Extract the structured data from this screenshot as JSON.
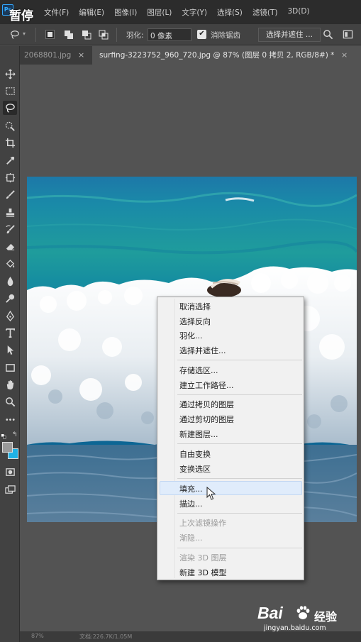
{
  "overlay": {
    "pause_label": "暂停"
  },
  "menubar": {
    "logo": "Ps",
    "items": [
      "文件(F)",
      "编辑(E)",
      "图像(I)",
      "图层(L)",
      "文字(Y)",
      "选择(S)",
      "滤镜(T)",
      "3D(D)"
    ]
  },
  "options_bar": {
    "feather_label": "羽化:",
    "feather_value": "0 像素",
    "antialias_label": "消除锯齿",
    "antialias_checked": true,
    "select_mask_label": "选择并遮住 ..."
  },
  "tabs": [
    {
      "label": "2068801.jpg",
      "close": "×"
    },
    {
      "label": "surfing-3223752_960_720.jpg @ 87% (图层 0 拷贝 2, RGB/8#) *",
      "close": "×"
    }
  ],
  "toolbar": {
    "tools": [
      "move-icon",
      "marquee-icon",
      "lasso-icon",
      "quick-select-icon",
      "crop-icon",
      "eyedropper-icon",
      "frame-icon",
      "brush-icon",
      "stamp-icon",
      "history-brush-icon",
      "eraser-icon",
      "paint-bucket-icon",
      "blur-icon",
      "dodge-icon",
      "pen-icon",
      "type-icon",
      "path-select-icon",
      "rectangle-icon",
      "hand-icon",
      "zoom-icon",
      "more-icon"
    ],
    "foreground_color": "#9a9a9a",
    "background_color": "#1fb2e6"
  },
  "context_menu": {
    "items": [
      {
        "label": "取消选择",
        "enabled": true
      },
      {
        "label": "选择反向",
        "enabled": true
      },
      {
        "label": "羽化...",
        "enabled": true
      },
      {
        "label": "选择并遮住...",
        "enabled": true
      },
      {
        "label": "存储选区...",
        "enabled": true
      },
      {
        "label": "建立工作路径...",
        "enabled": true
      },
      {
        "label": "通过拷贝的图层",
        "enabled": true
      },
      {
        "label": "通过剪切的图层",
        "enabled": true
      },
      {
        "label": "新建图层...",
        "enabled": true
      },
      {
        "label": "自由变换",
        "enabled": true
      },
      {
        "label": "变换选区",
        "enabled": true
      },
      {
        "label": "填充...",
        "enabled": true,
        "highlighted": true
      },
      {
        "label": "描边...",
        "enabled": true
      },
      {
        "label": "上次滤镜操作",
        "enabled": false
      },
      {
        "label": "渐隐...",
        "enabled": false
      },
      {
        "label": "渲染 3D 图层",
        "enabled": false
      },
      {
        "label": "新建 3D 模型",
        "enabled": true
      }
    ]
  },
  "status_bar": {
    "zoom": "87%",
    "doc_info": "文档:226.7K/1.05M"
  },
  "watermark": {
    "brand": "Bai",
    "brand_cn": "经验",
    "url": "jingyan.baidu.com"
  },
  "colors": {
    "ui_dark": "#2c2c2c",
    "ui_panel": "#424242",
    "canvas_bg": "#535353",
    "menu_highlight": "#e0ecfb",
    "sea": "#1e8fa0"
  }
}
